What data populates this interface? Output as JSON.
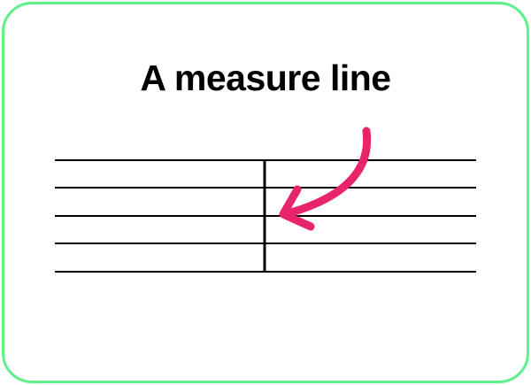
{
  "title": "A measure line",
  "staff": {
    "line_count": 5,
    "line_color": "#000000"
  },
  "arrow": {
    "color": "#e8246c",
    "target": "measure-line"
  },
  "border_color": "#5ef08a"
}
